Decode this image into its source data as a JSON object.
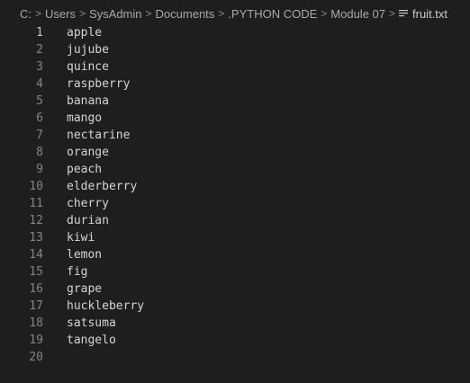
{
  "breadcrumb": {
    "items": [
      "C:",
      "Users",
      "SysAdmin",
      "Documents",
      ".PYTHON CODE",
      "Module 07"
    ],
    "file": "fruit.txt",
    "file_icon": "text-file-icon",
    "separator": ">"
  },
  "editor": {
    "active_line": 1,
    "lines": [
      {
        "num": "1",
        "text": "apple"
      },
      {
        "num": "2",
        "text": "jujube"
      },
      {
        "num": "3",
        "text": "quince"
      },
      {
        "num": "4",
        "text": "raspberry"
      },
      {
        "num": "5",
        "text": "banana"
      },
      {
        "num": "6",
        "text": "mango"
      },
      {
        "num": "7",
        "text": "nectarine"
      },
      {
        "num": "8",
        "text": "orange"
      },
      {
        "num": "9",
        "text": "peach"
      },
      {
        "num": "10",
        "text": "elderberry"
      },
      {
        "num": "11",
        "text": "cherry"
      },
      {
        "num": "12",
        "text": "durian"
      },
      {
        "num": "13",
        "text": "kiwi"
      },
      {
        "num": "14",
        "text": "lemon"
      },
      {
        "num": "15",
        "text": "fig"
      },
      {
        "num": "16",
        "text": "grape"
      },
      {
        "num": "17",
        "text": "huckleberry"
      },
      {
        "num": "18",
        "text": "satsuma"
      },
      {
        "num": "19",
        "text": "tangelo"
      },
      {
        "num": "20",
        "text": ""
      }
    ]
  },
  "colors": {
    "background": "#1e1e1e",
    "text": "#d4d4d4",
    "line_number": "#858585",
    "active_line_number": "#c6c6c6",
    "breadcrumb": "#a9a9a9"
  }
}
